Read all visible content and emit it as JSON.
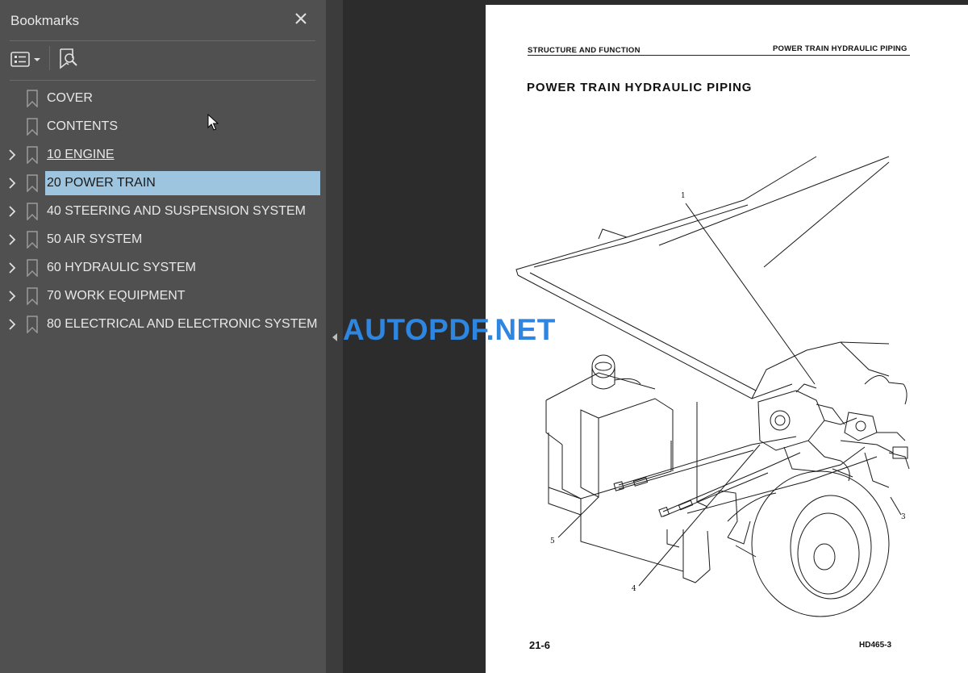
{
  "panel": {
    "title": "Bookmarks",
    "close_icon": "close-icon",
    "toolbar": {
      "options_icon": "bookmark-options-icon",
      "find_icon": "find-current-bookmark-icon"
    }
  },
  "bookmarks": [
    {
      "label": "COVER",
      "expandable": false,
      "state": "normal"
    },
    {
      "label": "CONTENTS",
      "expandable": false,
      "state": "normal"
    },
    {
      "label": "10 ENGINE",
      "expandable": true,
      "state": "hover"
    },
    {
      "label": "20 POWER TRAIN",
      "expandable": true,
      "state": "selected"
    },
    {
      "label": "40 STEERING AND SUSPENSION SYSTEM",
      "expandable": true,
      "state": "normal"
    },
    {
      "label": "50 AIR SYSTEM",
      "expandable": true,
      "state": "normal"
    },
    {
      "label": "60 HYDRAULIC SYSTEM",
      "expandable": true,
      "state": "normal"
    },
    {
      "label": "70 WORK EQUIPMENT",
      "expandable": true,
      "state": "normal"
    },
    {
      "label": "80 ELECTRICAL AND ELECTRONIC SYSTEM",
      "expandable": true,
      "state": "normal"
    }
  ],
  "page": {
    "header_left": "STRUCTURE AND FUNCTION",
    "header_right": "POWER TRAIN HYDRAULIC PIPING",
    "title": "POWER TRAIN HYDRAULIC PIPING",
    "callouts": {
      "c1": "1",
      "c3": "3",
      "c4": "4",
      "c5": "5"
    },
    "page_number": "21-6",
    "model": "HD465-3"
  },
  "watermark": "AUTOPDF.NET",
  "colors": {
    "panel_bg": "#505050",
    "selection": "#9ec5e0",
    "viewer_bg": "#2c2c2c",
    "watermark": "#2f86e0"
  }
}
